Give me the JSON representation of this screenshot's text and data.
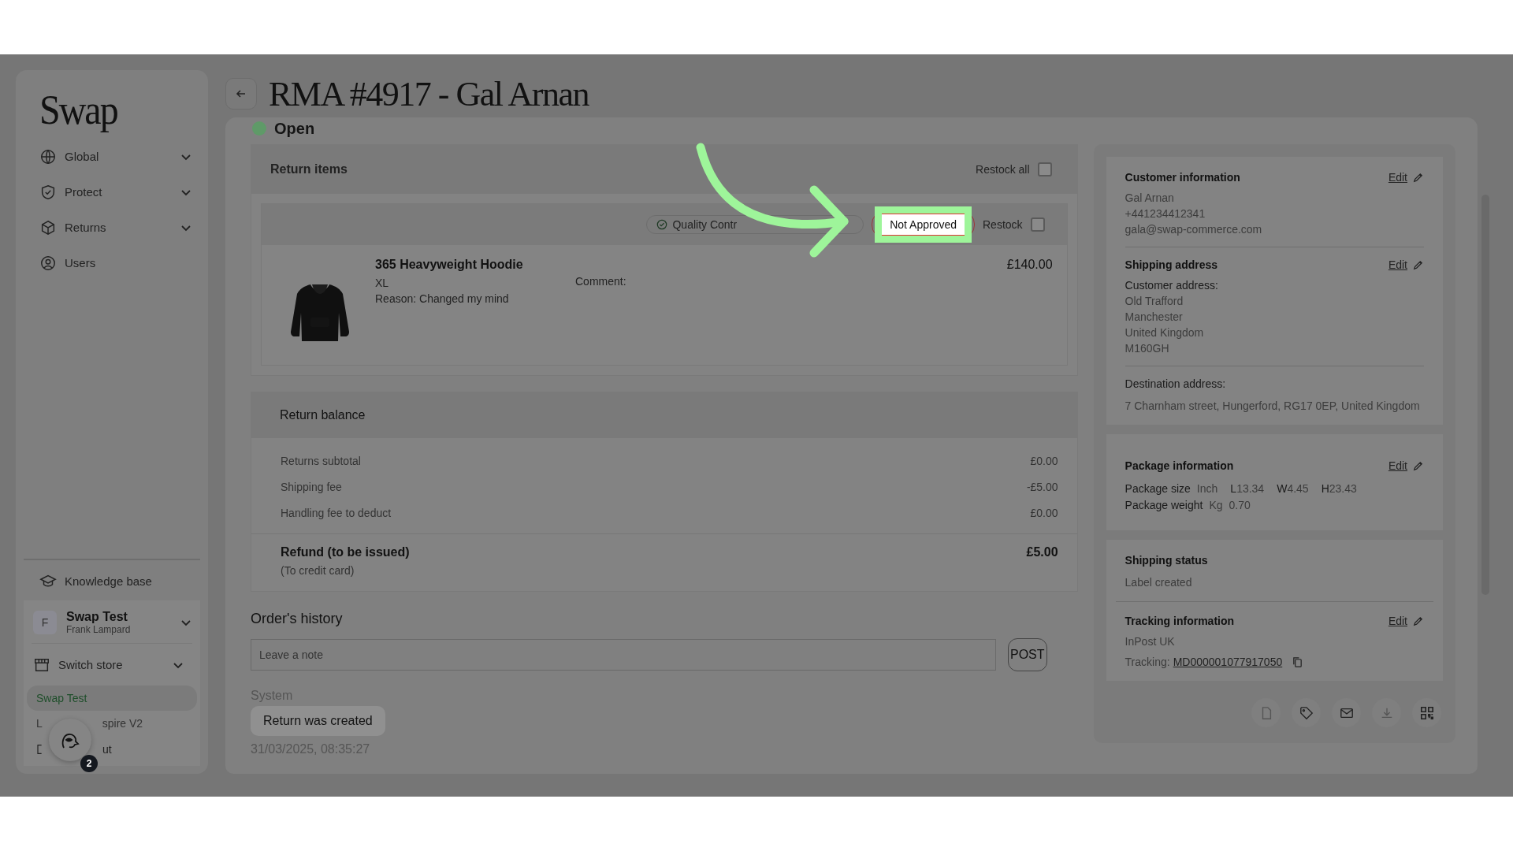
{
  "sidebar": {
    "logo": "Swap",
    "nav": [
      {
        "label": "Global",
        "expandable": true
      },
      {
        "label": "Protect",
        "expandable": true
      },
      {
        "label": "Returns",
        "expandable": true
      },
      {
        "label": "Users",
        "expandable": false
      }
    ],
    "knowledge_base": "Knowledge base",
    "account": {
      "initial": "F",
      "name": "Swap Test",
      "user": "Frank Lampard"
    },
    "switch_store": "Switch store",
    "stores": [
      {
        "label": "Swap Test",
        "selected": true
      },
      {
        "label": "L",
        "label_after": "spire V2",
        "selected": false
      }
    ],
    "logout_visible": "ut",
    "chat_badge": "2"
  },
  "header": {
    "title": "RMA #4917 - Gal Arnan",
    "status": "Open"
  },
  "return_items": {
    "title": "Return items",
    "restock_all": {
      "label": "Restock all",
      "checked": false
    },
    "items": [
      {
        "quality_control": "Quality Contr",
        "decision": {
          "label": "Not Approved",
          "highlighted": true
        },
        "restock": {
          "label": "Restock",
          "checked": false
        },
        "name": "365 Heavyweight Hoodie",
        "size": "XL",
        "reason": "Reason: Changed my mind",
        "comment_label": "Comment:",
        "price": "£140.00"
      }
    ]
  },
  "return_balance": {
    "title": "Return balance",
    "lines": [
      {
        "label": "Returns subtotal",
        "value": "£0.00"
      },
      {
        "label": "Shipping fee",
        "value": "-£5.00"
      },
      {
        "label": "Handling fee to deduct",
        "value": "£0.00"
      }
    ],
    "refund": {
      "label": "Refund (to be issued)",
      "note": "(To credit card)",
      "value": "£5.00"
    }
  },
  "history": {
    "title": "Order's history",
    "note": {
      "placeholder": "Leave a note"
    },
    "post": "POST",
    "entries": [
      {
        "author": "System",
        "text": "Return was created",
        "time": "31/03/2025, 08:35:27"
      }
    ]
  },
  "customer": {
    "title": "Customer information",
    "edit": "Edit",
    "lines": [
      "Gal Arnan",
      "+441234412341",
      "gala@swap-commerce.com"
    ]
  },
  "shipping_address": {
    "title": "Shipping address",
    "edit": "Edit",
    "customer_label": "Customer address:",
    "customer_lines": [
      "Old Trafford",
      "Manchester",
      "United Kingdom",
      "M160GH"
    ],
    "destination_label": "Destination address:",
    "destination": "7 Charnham street, Hungerford, RG17 0EP, United Kingdom"
  },
  "package": {
    "title": "Package information",
    "edit": "Edit",
    "size_label": "Package size",
    "size_unit": "Inch",
    "dims": [
      {
        "k": "L",
        "v": "13.34"
      },
      {
        "k": "W",
        "v": "4.45"
      },
      {
        "k": "H",
        "v": "23.43"
      }
    ],
    "weight_label": "Package weight",
    "weight_unit": "Kg",
    "weight": "0.70"
  },
  "shipping_status": {
    "title": "Shipping status",
    "value": "Label created"
  },
  "tracking": {
    "title": "Tracking information",
    "edit": "Edit",
    "carrier": "InPost UK",
    "label": "Tracking:",
    "number": "MD000001077917050"
  }
}
